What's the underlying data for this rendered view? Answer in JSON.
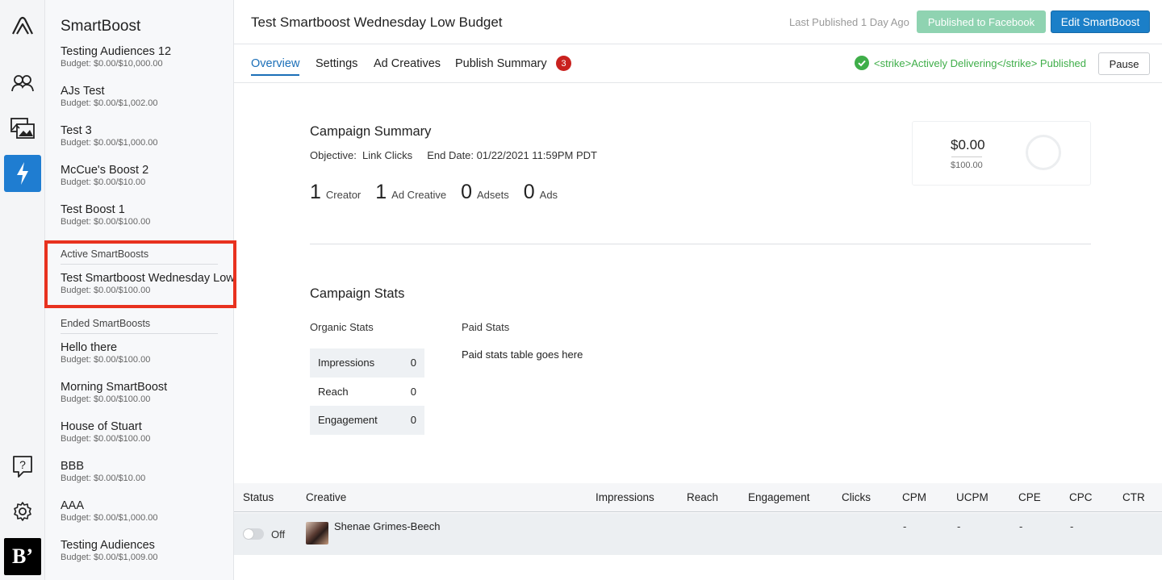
{
  "list": {
    "title": "SmartBoost",
    "items_top": [
      {
        "name": "Testing Audiences 12",
        "budget": "Budget: $0.00/$10,000.00"
      },
      {
        "name": "AJs Test",
        "budget": "Budget: $0.00/$1,002.00"
      },
      {
        "name": "Test 3",
        "budget": "Budget: $0.00/$1,000.00"
      },
      {
        "name": "McCue's Boost 2",
        "budget": "Budget: $0.00/$10.00"
      },
      {
        "name": "Test Boost 1",
        "budget": "Budget: $0.00/$100.00"
      }
    ],
    "active_label": "Active SmartBoosts",
    "active_items": [
      {
        "name": "Test Smartboost Wednesday Low Budget",
        "budget": "Budget: $0.00/$100.00"
      }
    ],
    "ended_label": "Ended SmartBoosts",
    "ended_items": [
      {
        "name": "Hello there",
        "budget": "Budget: $0.00/$100.00"
      },
      {
        "name": "Morning SmartBoost",
        "budget": "Budget: $0.00/$100.00"
      },
      {
        "name": "House of Stuart",
        "budget": "Budget: $0.00/$100.00"
      },
      {
        "name": "BBB",
        "budget": "Budget: $0.00/$10.00"
      },
      {
        "name": "AAA",
        "budget": "Budget: $0.00/$1,000.00"
      },
      {
        "name": "Testing Audiences",
        "budget": "Budget: $0.00/$1,009.00"
      }
    ]
  },
  "rail": {
    "icons": [
      "logo-icon",
      "audiences-icon",
      "creatives-icon",
      "smartboost-bolt-icon",
      "help-icon",
      "settings-gear-icon",
      "brand-b-icon"
    ],
    "brand_text": "B’"
  },
  "header": {
    "title": "Test Smartboost Wednesday Low Budget",
    "last_published": "Last Published 1 Day Ago",
    "published_button": "Published to Facebook",
    "edit_button": "Edit SmartBoost"
  },
  "tabs": {
    "items": [
      "Overview",
      "Settings",
      "Ad Creatives",
      "Publish Summary"
    ],
    "active": "Overview",
    "publish_badge": "3",
    "status_text": "<strike>Actively Delivering</strike> Published",
    "pause_button": "Pause"
  },
  "summary": {
    "title": "Campaign Summary",
    "objective": "Objective:  Link Clicks     End Date: 01/22/2021 11:59PM PDT",
    "counts": [
      {
        "value": "1",
        "label": "Creator"
      },
      {
        "value": "1",
        "label": "Ad Creative"
      },
      {
        "value": "0",
        "label": "Adsets"
      },
      {
        "value": "0",
        "label": "Ads"
      }
    ],
    "budget_spent": "$0.00",
    "budget_total": "$100.00",
    "budget_fraction": 0
  },
  "stats": {
    "title": "Campaign Stats",
    "organic_label": "Organic Stats",
    "paid_label": "Paid Stats",
    "organic_rows": [
      {
        "label": "Impressions",
        "value": "0"
      },
      {
        "label": "Reach",
        "value": "0"
      },
      {
        "label": "Engagement",
        "value": "0"
      }
    ],
    "paid_note": "Paid stats table goes here"
  },
  "creatives": {
    "columns": [
      "Status",
      "Creative",
      "Impressions",
      "Reach",
      "Engagement",
      "Clicks",
      "CPM",
      "UCPM",
      "CPE",
      "CPC",
      "CTR"
    ],
    "rows": [
      {
        "status": "Off",
        "creator": "Shenae Grimes-Beech",
        "cpm": "-",
        "ucpm": "-",
        "cpe": "-",
        "cpc": "-"
      }
    ]
  },
  "colors": {
    "accent": "#1b7fc8",
    "success": "#3fae49",
    "highlight": "#e8321f",
    "badge": "#c9211e"
  }
}
